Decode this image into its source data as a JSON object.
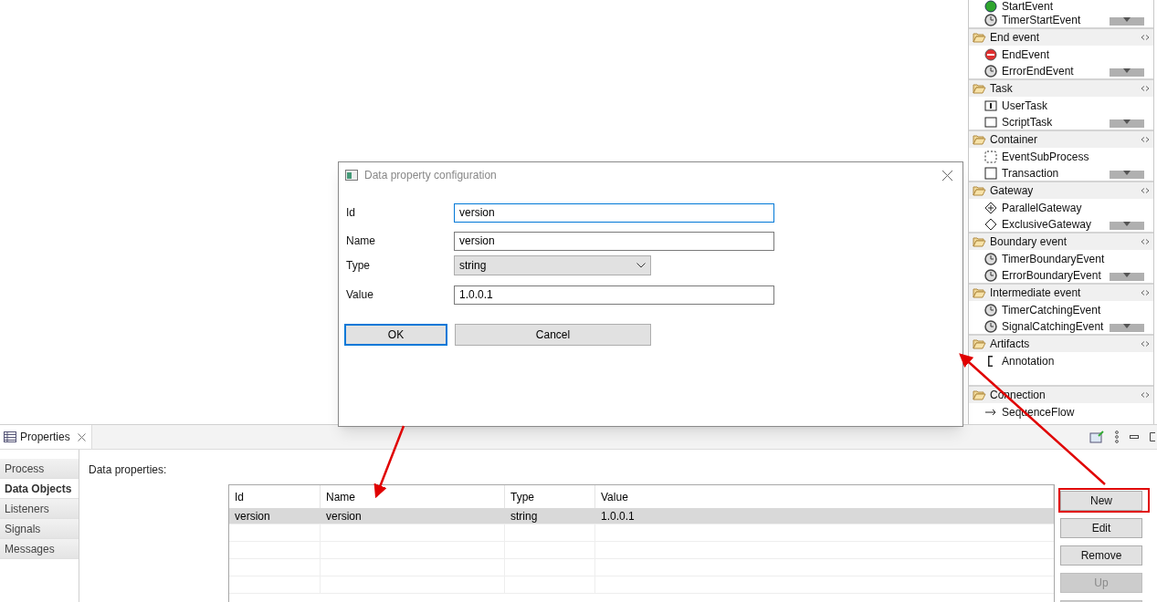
{
  "palette": {
    "top_items": [
      {
        "label": "StartEvent"
      },
      {
        "label": "TimerStartEvent"
      }
    ],
    "groups": [
      {
        "title": "End event",
        "items": [
          {
            "label": "EndEvent"
          },
          {
            "label": "ErrorEndEvent"
          }
        ]
      },
      {
        "title": "Task",
        "items": [
          {
            "label": "UserTask"
          },
          {
            "label": "ScriptTask"
          }
        ]
      },
      {
        "title": "Container",
        "items": [
          {
            "label": "EventSubProcess"
          },
          {
            "label": "Transaction"
          }
        ]
      },
      {
        "title": "Gateway",
        "items": [
          {
            "label": "ParallelGateway"
          },
          {
            "label": "ExclusiveGateway"
          }
        ]
      },
      {
        "title": "Boundary event",
        "items": [
          {
            "label": "TimerBoundaryEvent"
          },
          {
            "label": "ErrorBoundaryEvent"
          }
        ]
      },
      {
        "title": "Intermediate event",
        "items": [
          {
            "label": "TimerCatchingEvent"
          },
          {
            "label": "SignalCatchingEvent"
          }
        ]
      },
      {
        "title": "Artifacts",
        "items": [
          {
            "label": "Annotation"
          }
        ]
      },
      {
        "title": "Connection",
        "items": [
          {
            "label": "SequenceFlow"
          }
        ]
      }
    ]
  },
  "dialog": {
    "title": "Data property configuration",
    "fields": [
      {
        "label": "Id",
        "kind": "text",
        "value": "version",
        "focused": true
      },
      {
        "label": "Name",
        "kind": "text",
        "value": "version",
        "focused": false
      },
      {
        "label": "Type",
        "kind": "select",
        "value": "string"
      },
      {
        "label": "Value",
        "kind": "text",
        "value": "1.0.0.1",
        "focused": false
      }
    ],
    "buttons": [
      {
        "label": "OK",
        "default": true
      },
      {
        "label": "Cancel",
        "default": false
      }
    ]
  },
  "properties": {
    "tab": "Properties",
    "side_tabs": [
      {
        "label": "Process",
        "selected": false
      },
      {
        "label": "Data Objects",
        "selected": true
      },
      {
        "label": "Listeners",
        "selected": false
      },
      {
        "label": "Signals",
        "selected": false
      },
      {
        "label": "Messages",
        "selected": false
      }
    ],
    "section_label": "Data properties:",
    "table": {
      "columns": [
        "Id",
        "Name",
        "Type",
        "Value"
      ],
      "rows": [
        {
          "cells": [
            "version",
            "version",
            "string",
            "1.0.0.1"
          ],
          "selected": true
        }
      ]
    },
    "buttons": [
      {
        "label": "New",
        "disabled": false,
        "highlighted": true
      },
      {
        "label": "Edit",
        "disabled": false,
        "highlighted": false
      },
      {
        "label": "Remove",
        "disabled": false,
        "highlighted": false
      },
      {
        "label": "Up",
        "disabled": true,
        "highlighted": false
      }
    ]
  }
}
